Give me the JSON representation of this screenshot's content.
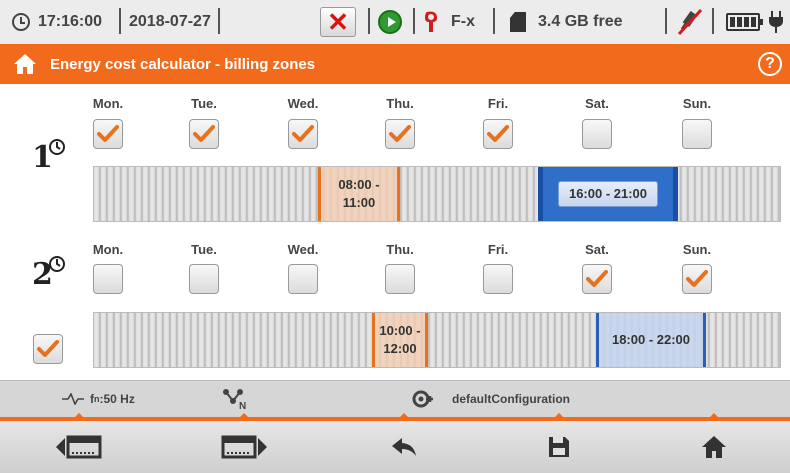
{
  "status_bar": {
    "time": "17:16:00",
    "date": "2018-07-27",
    "clamp_label": "F-x",
    "storage": "3.4 GB free"
  },
  "title_bar": {
    "title": "Energy cost calculator - billing zones"
  },
  "zone1": {
    "days": [
      {
        "label": "Mon.",
        "checked": true
      },
      {
        "label": "Tue.",
        "checked": true
      },
      {
        "label": "Wed.",
        "checked": true
      },
      {
        "label": "Thu.",
        "checked": true
      },
      {
        "label": "Fri.",
        "checked": true
      },
      {
        "label": "Sat.",
        "checked": false
      },
      {
        "label": "Sun.",
        "checked": false
      }
    ],
    "ranges": [
      {
        "label_line1": "08:00 -",
        "label_line2": "11:00"
      },
      {
        "label": "16:00 - 21:00"
      }
    ]
  },
  "zone2": {
    "enabled": true,
    "days": [
      {
        "label": "Mon.",
        "checked": false
      },
      {
        "label": "Tue.",
        "checked": false
      },
      {
        "label": "Wed.",
        "checked": false
      },
      {
        "label": "Thu.",
        "checked": false
      },
      {
        "label": "Fri.",
        "checked": false
      },
      {
        "label": "Sat.",
        "checked": true
      },
      {
        "label": "Sun.",
        "checked": true
      }
    ],
    "ranges": [
      {
        "label_line1": "10:00 -",
        "label_line2": "12:00"
      },
      {
        "label": "18:00 - 22:00"
      }
    ]
  },
  "info_bar": {
    "frequency_symbol": "f",
    "frequency_subscript": "n",
    "frequency_value": ":50 Hz",
    "config_name": "defaultConfiguration"
  },
  "colors": {
    "accent": "#f26a1b",
    "check": "#e8711d",
    "range_blue": "#2f6fc9"
  },
  "icons": {
    "toolbar": [
      "prev-screen-icon",
      "next-screen-icon",
      "back-icon",
      "save-icon",
      "home-icon"
    ]
  }
}
